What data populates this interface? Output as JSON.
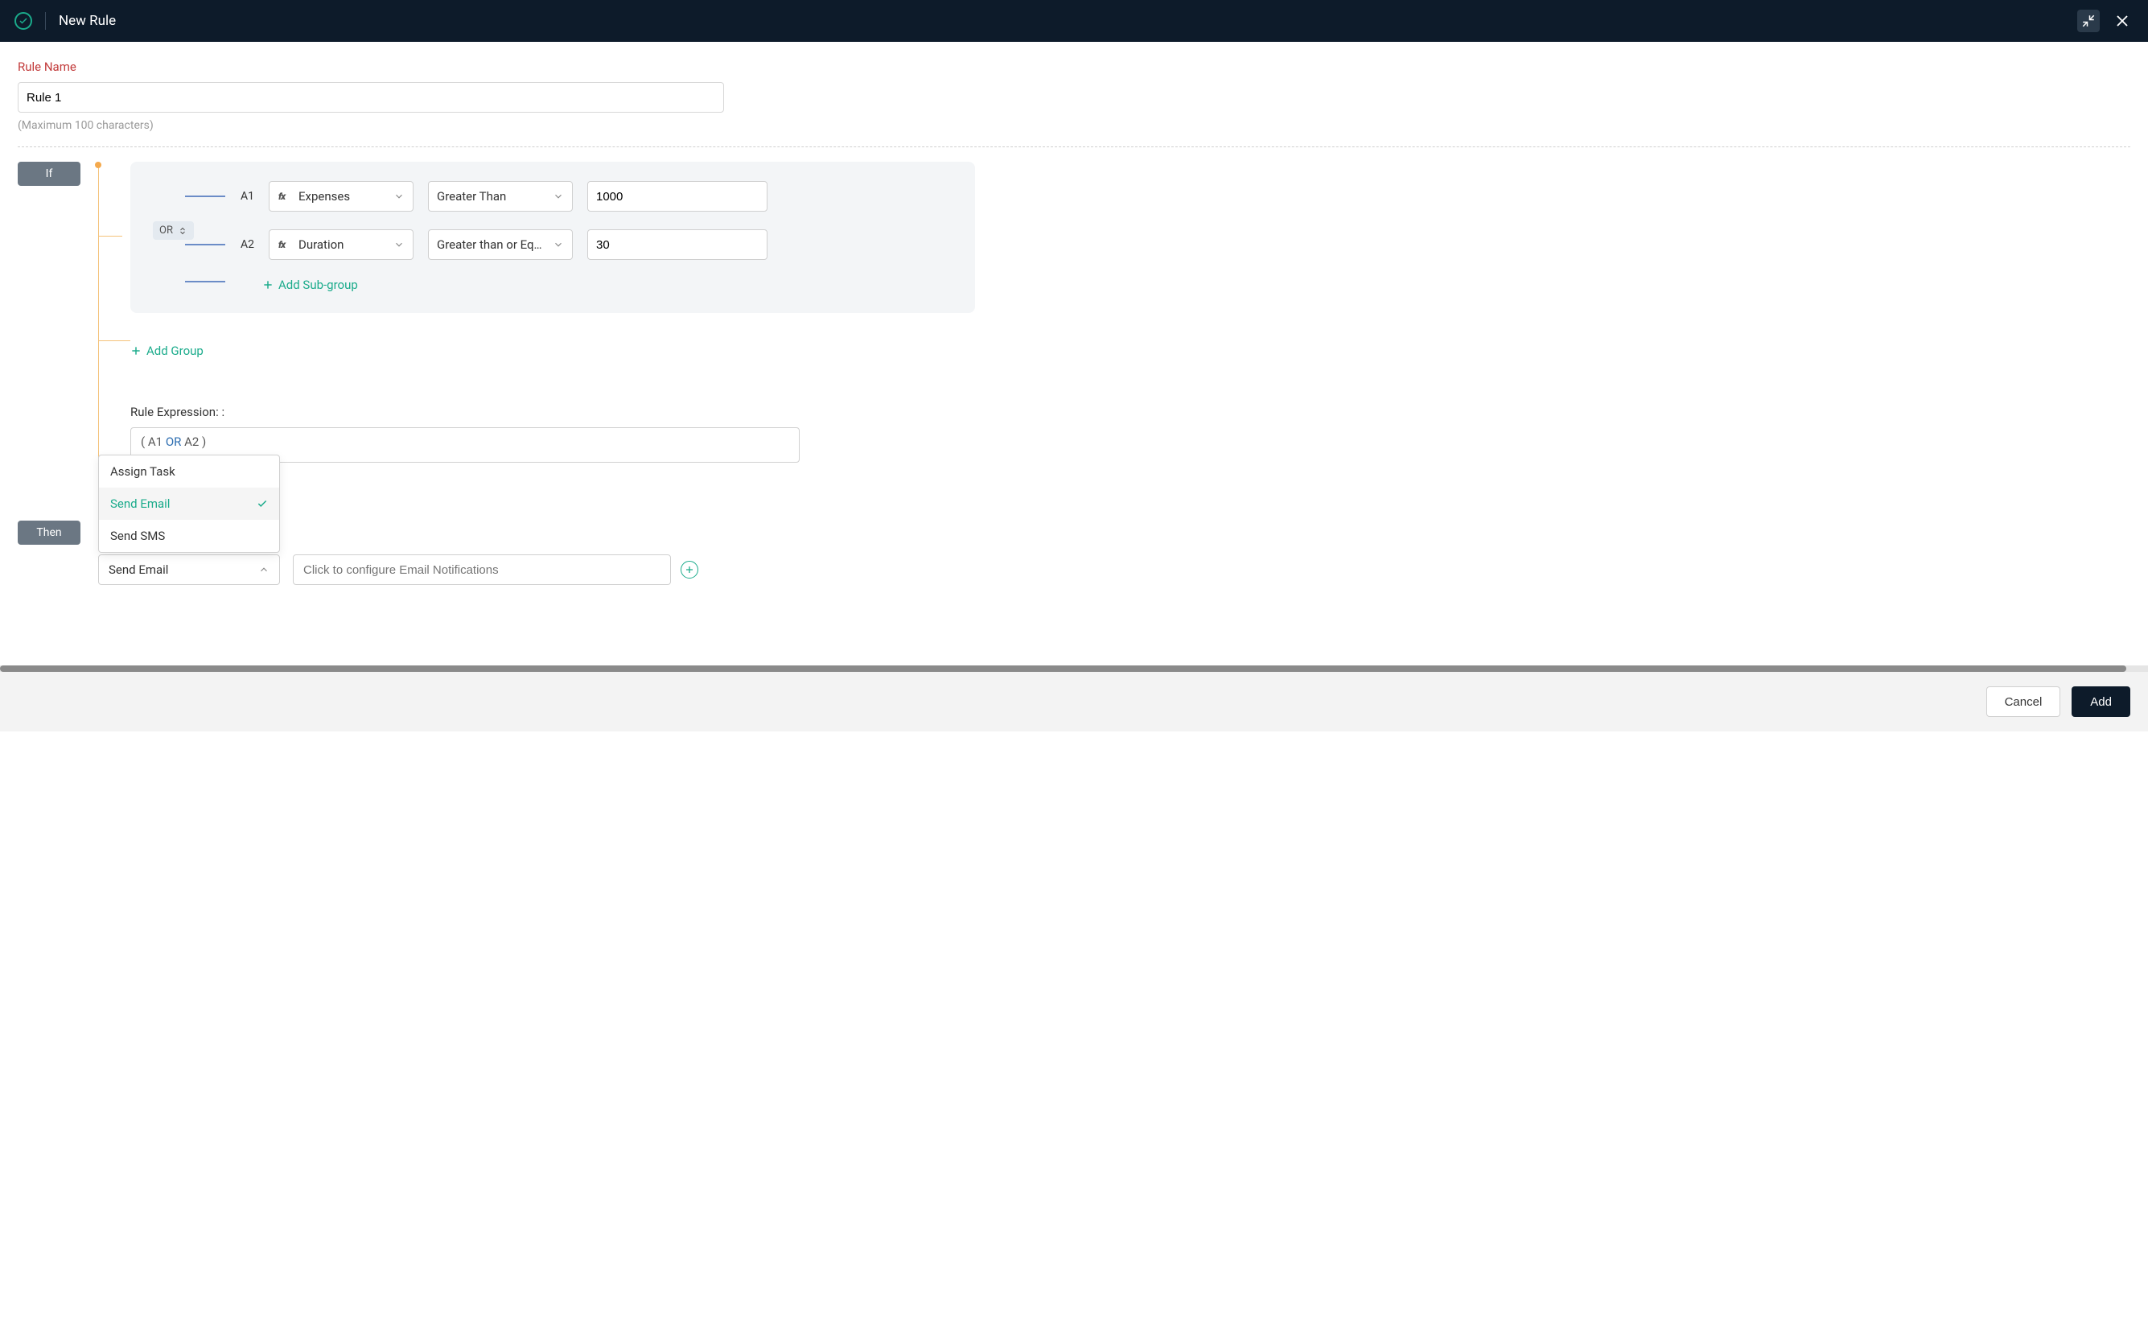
{
  "header": {
    "title": "New Rule"
  },
  "form": {
    "rule_name_label": "Rule Name",
    "rule_name_value": "Rule 1",
    "rule_name_hint": "(Maximum 100 characters)"
  },
  "builder": {
    "if_label": "If",
    "then_label": "Then",
    "group_operator": "OR",
    "conditions": [
      {
        "id": "A1",
        "field": "Expenses",
        "operator": "Greater Than",
        "value": "1000"
      },
      {
        "id": "A2",
        "field": "Duration",
        "operator": "Greater than or Equ…",
        "value": "30"
      }
    ],
    "add_subgroup": "Add Sub-group",
    "add_group": "Add Group",
    "expr_label": "Rule Expression: :",
    "expr_parts": {
      "open": "(  A1",
      "op": "OR",
      "close": "A2  )"
    }
  },
  "then": {
    "dropdown_options": [
      {
        "label": "Assign Task",
        "selected": false
      },
      {
        "label": "Send Email",
        "selected": true
      },
      {
        "label": "Send SMS",
        "selected": false
      }
    ],
    "selected_action": "Send Email",
    "config_placeholder": "Click to configure Email Notifications"
  },
  "footer": {
    "cancel": "Cancel",
    "submit": "Add"
  }
}
